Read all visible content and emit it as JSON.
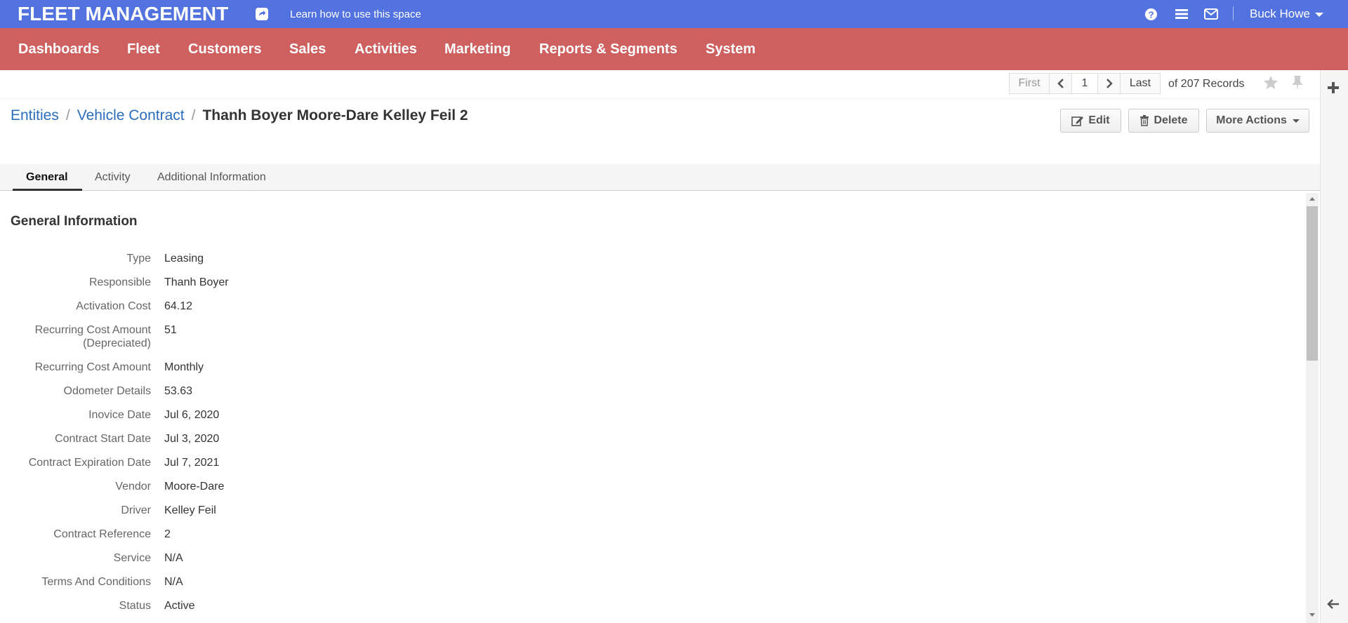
{
  "header": {
    "app_title": "FLEET MANAGEMENT",
    "learn_link": "Learn how to use this space",
    "user_name": "Buck Howe",
    "icons": [
      "help-icon",
      "menu-icon",
      "mail-icon"
    ],
    "background_color": "#5273df"
  },
  "nav": {
    "background_color": "#cf6060",
    "items": [
      "Dashboards",
      "Fleet",
      "Customers",
      "Sales",
      "Activities",
      "Marketing",
      "Reports & Segments",
      "System"
    ]
  },
  "pager": {
    "first": "First",
    "page": "1",
    "last": "Last",
    "records": "of 207 Records"
  },
  "breadcrumb": {
    "items": [
      "Entities",
      "Vehicle Contract"
    ],
    "current": "Thanh Boyer Moore-Dare Kelley Feil 2"
  },
  "actions": {
    "edit": "Edit",
    "delete": "Delete",
    "more": "More Actions"
  },
  "tabs": [
    "General",
    "Activity",
    "Additional Information"
  ],
  "section_title": "General Information",
  "fields": [
    {
      "label": "Type",
      "value": "Leasing"
    },
    {
      "label": "Responsible",
      "value": "Thanh Boyer"
    },
    {
      "label": "Activation Cost",
      "value": "64.12"
    },
    {
      "label": "Recurring Cost Amount",
      "label2": "(Depreciated)",
      "value": "51"
    },
    {
      "label": "Recurring Cost Amount",
      "value": "Monthly"
    },
    {
      "label": "Odometer Details",
      "value": "53.63"
    },
    {
      "label": "Inovice Date",
      "value": "Jul 6, 2020"
    },
    {
      "label": "Contract Start Date",
      "value": "Jul 3, 2020"
    },
    {
      "label": "Contract Expiration Date",
      "value": "Jul 7, 2021"
    },
    {
      "label": "Vendor",
      "value": "Moore-Dare"
    },
    {
      "label": "Driver",
      "value": "Kelley Feil"
    },
    {
      "label": "Contract Reference",
      "value": "2"
    },
    {
      "label": "Service",
      "value": "N/A"
    },
    {
      "label": "Terms And Conditions",
      "value": "N/A"
    },
    {
      "label": "Status",
      "value": "Active"
    }
  ]
}
